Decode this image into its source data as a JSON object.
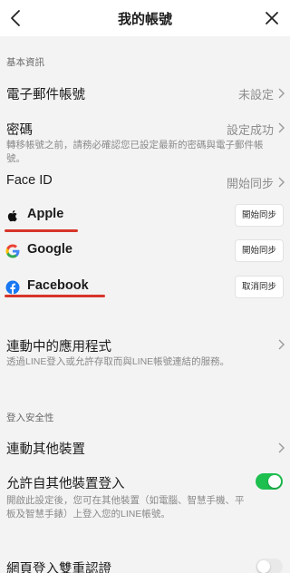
{
  "header": {
    "title": "我的帳號",
    "back_icon": "chevron-left-icon",
    "close_icon": "close-x-icon"
  },
  "basic_info": {
    "section_label": "基本資訊",
    "email_label": "電子郵件帳號",
    "email_value": "未設定",
    "password_label": "密碼",
    "password_value": "設定成功",
    "password_desc": "轉移帳號之前，請務必確認您已設定最新的密碼與電子郵件帳號。",
    "faceid_label": "Face ID",
    "faceid_value": "開始同步"
  },
  "providers": [
    {
      "name": "Apple",
      "button": "開始同步",
      "icon": "apple-logo-icon"
    },
    {
      "name": "Google",
      "button": "開始同步",
      "icon": "google-logo-icon"
    },
    {
      "name": "Facebook",
      "button": "取消同步",
      "icon": "facebook-logo-icon"
    }
  ],
  "connected_apps": {
    "label": "連動中的應用程式",
    "desc": "透過LINE登入或允許存取而與LINE帳號連結的服務。"
  },
  "login_security": {
    "section_label": "登入安全性",
    "link_devices_label": "連動其他裝置",
    "allow_other_devices_label": "允許自其他裝置登入",
    "allow_other_devices_on": true,
    "allow_other_devices_desc": "開啟此設定後，您可在其他裝置（如電腦、智慧手機、平板及智慧手錶）上登入您的LINE帳號。",
    "two_step_label": "網頁登入雙重認證",
    "two_step_on": false
  },
  "colors": {
    "background": "#f3f3f3",
    "toggle_on": "#1dbf4f",
    "highlight_underline": "#d8352a",
    "facebook_blue": "#1877f2"
  }
}
